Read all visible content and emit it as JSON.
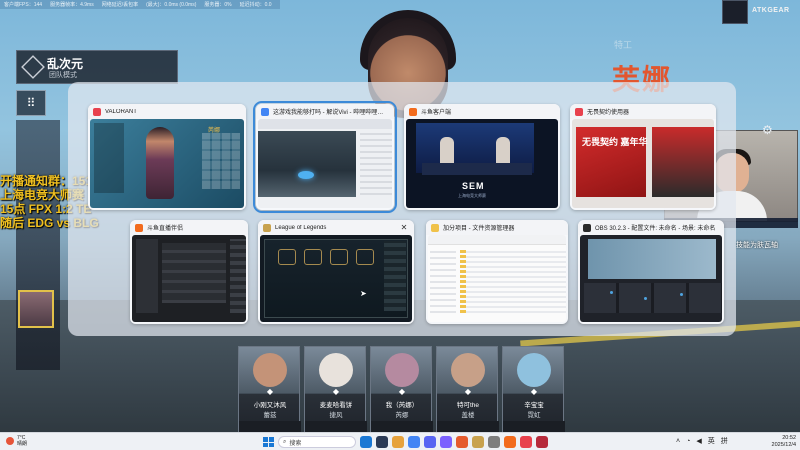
{
  "stream_overlay": {
    "top_info": [
      "客户端FPS：144",
      "服务器帧率：4.9ms",
      "网络延迟/丢包率",
      "(最大)：0.0ms (0.0ms)",
      "服务器：0%",
      "延迟抖动：0.0"
    ],
    "brand": "ATKGEAR",
    "team_name": "乱次元",
    "team_sub": "团队模式",
    "lines": [
      "开播通知群：151646328",
      "上海电竞大师赛（邀请赛）",
      "15点 FPX 1:2 TE",
      "随后 EDG vs BLG"
    ],
    "hero_label": "特工",
    "hero_name": "芙娜",
    "facecam_tag": "LEVIATAN",
    "right_caption": "技能为肤瓦轴"
  },
  "agents": [
    {
      "player": "小刚又沐风",
      "hero": "蕾兹",
      "role": "◆"
    },
    {
      "player": "麦麦哈看饼",
      "hero": "捷风",
      "role": "◆"
    },
    {
      "player": "我（芮娜）",
      "hero": "芮娜",
      "role": "◆"
    },
    {
      "player": "特可the",
      "hero": "盖楼",
      "role": "◆"
    },
    {
      "player": "辛宝宝",
      "hero": "霓虹",
      "role": "◆"
    }
  ],
  "task_view": {
    "windows": [
      {
        "title": "VALORANT",
        "icon_color": "#e8414d",
        "thumb_label": "芮娜"
      },
      {
        "title": "这游戏我能够打吗 - 解说Vivi - 哔哩哔哩直播，二次元弹幕直播平台",
        "icon_color": "#4285f4"
      },
      {
        "title": "斗鱼客户端",
        "icon_color": "#f26b1d",
        "stream_logo": "SEM",
        "stream_logo_sub": "上海电竞大师赛"
      },
      {
        "title": "无畏契约使用器",
        "icon_color": "#e8414d",
        "banner_text": "无畏契约 嘉年华"
      },
      {
        "title": "斗鱼直播伴侣",
        "icon_color": "#f26b1d"
      },
      {
        "title": "League of Legends",
        "icon_color": "#c8a24e"
      },
      {
        "title": "加分项目 - 文件资源管理器",
        "icon_color": "#f0c24a"
      },
      {
        "title": "OBS 30.2.3 - 配置文件: 未命名 - 场景: 未命名",
        "icon_color": "#2b2b2b"
      }
    ]
  },
  "taskbar": {
    "weather_temp": "7°C",
    "weather_desc": "晴朗",
    "search_placeholder": "搜索",
    "apps": [
      "#1a78d4",
      "#2b3a55",
      "#e6a23c",
      "#4285f4",
      "#5865f2",
      "#7b61ff",
      "#e55b2d",
      "#c8a24e",
      "#7d7d7d",
      "#f26b1d",
      "#e8414d",
      "#b62a3b"
    ],
    "tray_input": "英",
    "tray_ime": "拼",
    "time": "20:52",
    "date": "2025/12/4"
  }
}
